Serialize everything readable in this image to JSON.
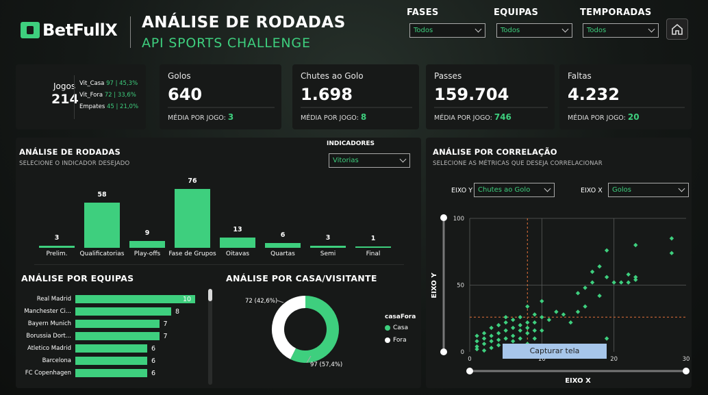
{
  "header": {
    "logo_text": "BetFullX",
    "title": "ANÁLISE DE RODADAS",
    "subtitle": "API SPORTS CHALLENGE"
  },
  "filters": [
    {
      "label": "FASES",
      "value": "Todos"
    },
    {
      "label": "EQUIPAS",
      "value": "Todos"
    },
    {
      "label": "TEMPORADAS",
      "value": "Todos"
    }
  ],
  "kpis": {
    "jogos": {
      "label": "Jogos",
      "value": "214",
      "rows": [
        {
          "label": "Vit_Casa",
          "value": "97 | 45,3%"
        },
        {
          "label": "Vit_Fora",
          "value": "72 | 33,6%"
        },
        {
          "label": "Empates",
          "value": "45 | 21,0%"
        }
      ]
    },
    "cards": [
      {
        "label": "Golos",
        "value": "640",
        "foot": "MÉDIA POR JOGO:",
        "avg": "3"
      },
      {
        "label": "Chutes ao Golo",
        "value": "1.698",
        "foot": "MÉDIA POR JOGO:",
        "avg": "8"
      },
      {
        "label": "Passes",
        "value": "159.704",
        "foot": "MÉDIA POR JOGO:",
        "avg": "746"
      },
      {
        "label": "Faltas",
        "value": "4.232",
        "foot": "MÉDIA POR JOGO:",
        "avg": "20"
      }
    ]
  },
  "rounds": {
    "title": "ANÁLISE DE RODADAS",
    "subtitle": "SELECIONE O INDICADOR DESEJADO",
    "indicator_label": "INDICADORES",
    "indicator_value": "Vitorias"
  },
  "teams": {
    "title": "ANÁLISE POR EQUIPAS"
  },
  "homeaway": {
    "title": "ANÁLISE POR CASA/VISITANTE",
    "legend_title": "casaFora"
  },
  "correlation": {
    "title": "ANÁLISE POR CORRELAÇÃO",
    "subtitle": "SELECIONE AS MÉTRICAS QUE DESEJA CORRELACIONAR",
    "eixo_y_label": "EIXO Y",
    "eixo_y_value": "Chutes ao Golo",
    "eixo_x_label": "EIXO X",
    "eixo_x_value": "Golos",
    "capture_button": "Capturar tela"
  },
  "chart_data": [
    {
      "type": "bar",
      "categories": [
        "Prelim.",
        "Qualificatorias",
        "Play-offs",
        "Fase de Grupos",
        "Oitavas",
        "Quartas",
        "Semi",
        "Final"
      ],
      "values": [
        3,
        58,
        9,
        76,
        13,
        6,
        3,
        1
      ]
    },
    {
      "type": "bar",
      "orientation": "horizontal",
      "categories": [
        "Real Madrid",
        "Manchester Ci...",
        "Bayern Munich",
        "Borussia Dort...",
        "Atletico Madrid",
        "Barcelona",
        "FC Copenhagen"
      ],
      "values": [
        10,
        8,
        7,
        7,
        6,
        6,
        6
      ]
    },
    {
      "type": "pie",
      "series": [
        {
          "name": "Casa",
          "value": 97,
          "label": "97 (57,4%)",
          "color": "#3ecf7e"
        },
        {
          "name": "Fora",
          "value": 72,
          "label": "72 (42,6%)",
          "color": "#ffffff"
        }
      ]
    },
    {
      "type": "scatter",
      "xlabel": "EIXO X",
      "ylabel": "EIXO Y",
      "xlim": [
        0,
        30
      ],
      "ylim": [
        0,
        100
      ],
      "xticks": [
        "0",
        "10",
        "20",
        "30"
      ],
      "yticks": [
        "0",
        "50",
        "100"
      ],
      "points": [
        [
          1,
          2
        ],
        [
          1,
          4
        ],
        [
          1,
          8
        ],
        [
          1,
          12
        ],
        [
          2,
          1
        ],
        [
          2,
          6
        ],
        [
          2,
          10
        ],
        [
          2,
          14
        ],
        [
          3,
          3
        ],
        [
          3,
          8
        ],
        [
          3,
          12
        ],
        [
          3,
          18
        ],
        [
          4,
          5
        ],
        [
          4,
          9
        ],
        [
          4,
          14
        ],
        [
          4,
          20
        ],
        [
          5,
          4
        ],
        [
          5,
          10
        ],
        [
          5,
          16
        ],
        [
          5,
          22
        ],
        [
          5,
          26
        ],
        [
          6,
          8
        ],
        [
          6,
          12
        ],
        [
          6,
          18
        ],
        [
          6,
          24
        ],
        [
          7,
          3
        ],
        [
          7,
          10
        ],
        [
          7,
          16
        ],
        [
          7,
          20
        ],
        [
          7,
          26
        ],
        [
          8,
          6
        ],
        [
          8,
          14
        ],
        [
          8,
          18
        ],
        [
          8,
          22
        ],
        [
          8,
          34
        ],
        [
          9,
          10
        ],
        [
          9,
          16
        ],
        [
          9,
          22
        ],
        [
          9,
          28
        ],
        [
          10,
          16
        ],
        [
          10,
          26
        ],
        [
          10,
          38
        ],
        [
          11,
          24
        ],
        [
          12,
          30
        ],
        [
          13,
          28
        ],
        [
          14,
          22
        ],
        [
          15,
          30
        ],
        [
          15,
          44
        ],
        [
          16,
          34
        ],
        [
          16,
          48
        ],
        [
          17,
          52
        ],
        [
          17,
          60
        ],
        [
          18,
          42
        ],
        [
          18,
          64
        ],
        [
          19,
          10
        ],
        [
          19,
          56
        ],
        [
          19,
          76
        ],
        [
          20,
          52
        ],
        [
          21,
          52
        ],
        [
          22,
          52
        ],
        [
          22,
          58
        ],
        [
          23,
          54
        ],
        [
          23,
          56
        ],
        [
          23,
          80
        ],
        [
          28,
          74
        ],
        [
          28,
          85
        ]
      ]
    }
  ]
}
